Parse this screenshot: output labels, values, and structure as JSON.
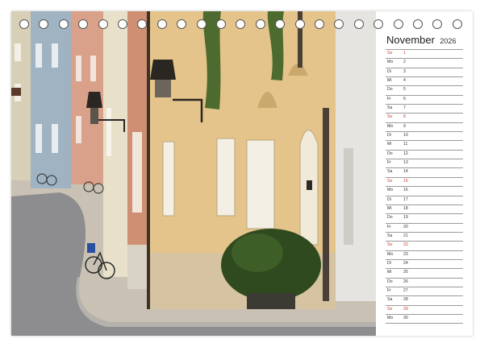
{
  "calendar": {
    "month": "November",
    "year": "2026",
    "days": [
      {
        "dow": "So",
        "num": "1",
        "sunday": true
      },
      {
        "dow": "Mo",
        "num": "2",
        "sunday": false
      },
      {
        "dow": "Di",
        "num": "3",
        "sunday": false
      },
      {
        "dow": "Mi",
        "num": "4",
        "sunday": false
      },
      {
        "dow": "Do",
        "num": "5",
        "sunday": false
      },
      {
        "dow": "Fr",
        "num": "6",
        "sunday": false
      },
      {
        "dow": "Sa",
        "num": "7",
        "sunday": false
      },
      {
        "dow": "So",
        "num": "8",
        "sunday": true
      },
      {
        "dow": "Mo",
        "num": "9",
        "sunday": false
      },
      {
        "dow": "Di",
        "num": "10",
        "sunday": false
      },
      {
        "dow": "Mi",
        "num": "11",
        "sunday": false
      },
      {
        "dow": "Do",
        "num": "12",
        "sunday": false
      },
      {
        "dow": "Fr",
        "num": "13",
        "sunday": false
      },
      {
        "dow": "Sa",
        "num": "14",
        "sunday": false
      },
      {
        "dow": "So",
        "num": "15",
        "sunday": true
      },
      {
        "dow": "Mo",
        "num": "16",
        "sunday": false
      },
      {
        "dow": "Di",
        "num": "17",
        "sunday": false
      },
      {
        "dow": "Mi",
        "num": "18",
        "sunday": false
      },
      {
        "dow": "Do",
        "num": "19",
        "sunday": false
      },
      {
        "dow": "Fr",
        "num": "20",
        "sunday": false
      },
      {
        "dow": "Sa",
        "num": "21",
        "sunday": false
      },
      {
        "dow": "So",
        "num": "22",
        "sunday": true
      },
      {
        "dow": "Mo",
        "num": "23",
        "sunday": false
      },
      {
        "dow": "Di",
        "num": "24",
        "sunday": false
      },
      {
        "dow": "Mi",
        "num": "25",
        "sunday": false
      },
      {
        "dow": "Do",
        "num": "26",
        "sunday": false
      },
      {
        "dow": "Fr",
        "num": "27",
        "sunday": false
      },
      {
        "dow": "Sa",
        "num": "28",
        "sunday": false
      },
      {
        "dow": "So",
        "num": "29",
        "sunday": true
      },
      {
        "dow": "Mo",
        "num": "30",
        "sunday": false
      }
    ]
  },
  "colors": {
    "sunday": "#c0392b",
    "ruling": "#9a9a9a",
    "facade_yellow": "#e4c48a",
    "facade_pink": "#d9a08a",
    "facade_blue": "#9fb3c2",
    "road": "#8d8d8f"
  },
  "binding": {
    "ring_count": 23
  }
}
